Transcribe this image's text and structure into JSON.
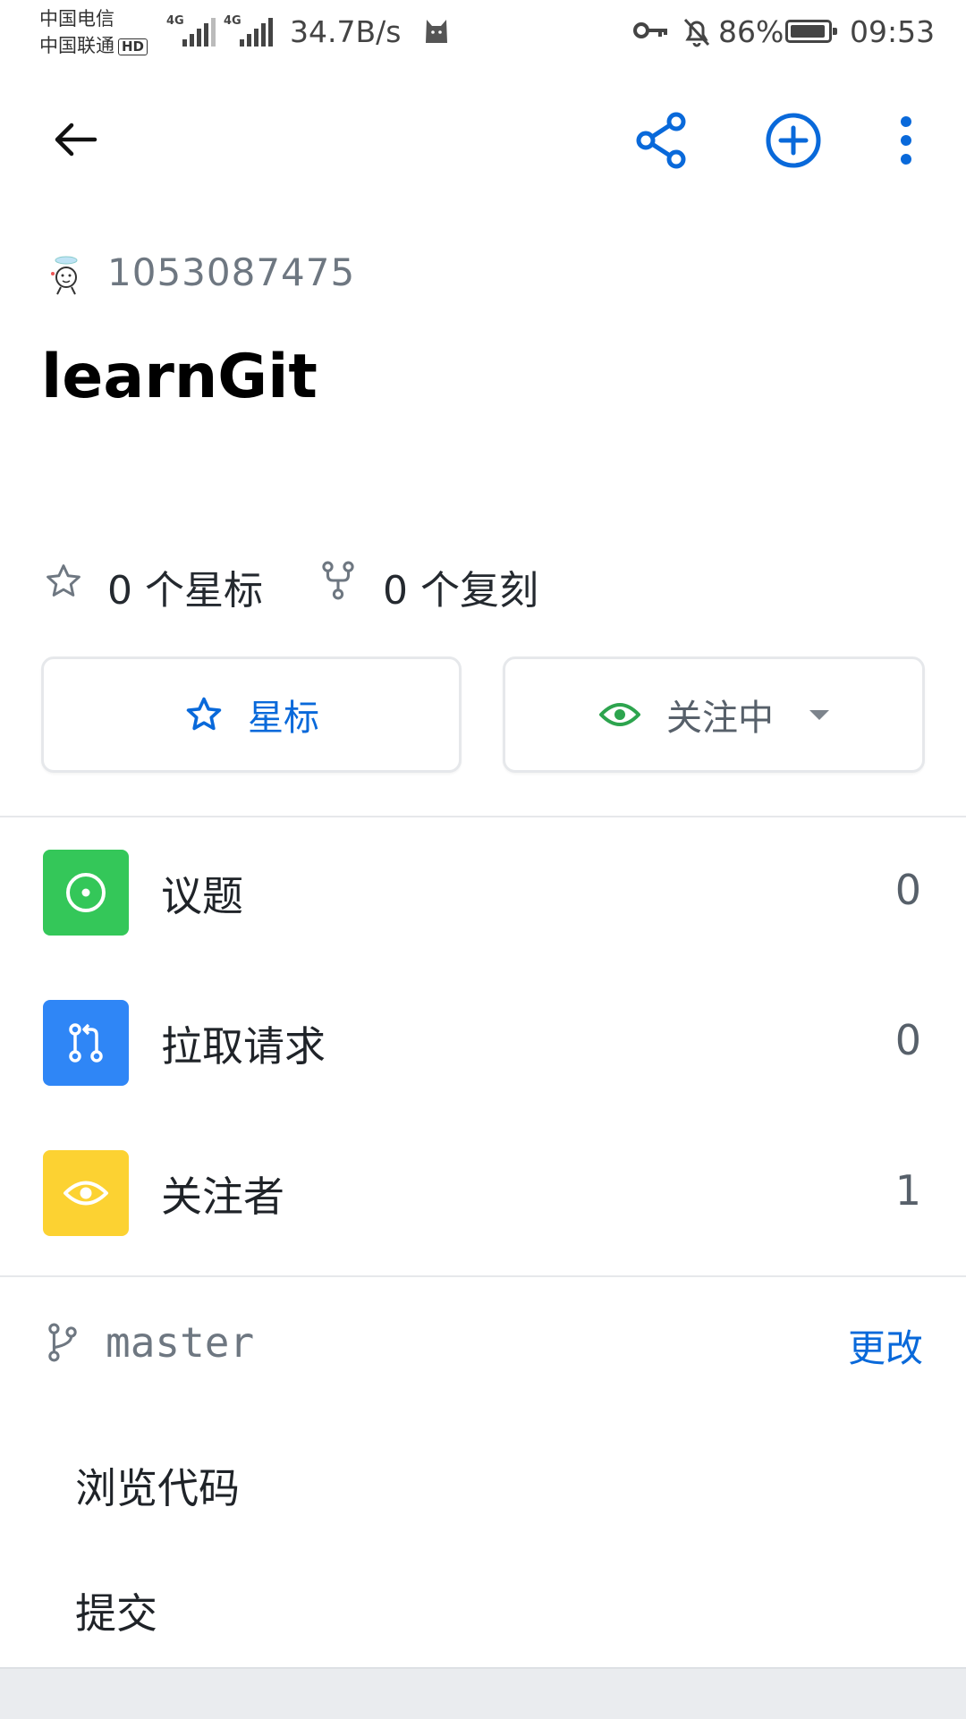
{
  "status_bar": {
    "carrier1": "中国电信",
    "carrier2": "中国联通",
    "hd_badge": "HD",
    "network1": "4G",
    "network2": "4G",
    "net_speed": "34.7B/s",
    "battery": "86%",
    "battery_level": 0.86,
    "time": "09:53",
    "icons": [
      "signal-icon",
      "cat-icon",
      "key-icon",
      "bell-off-icon",
      "battery-icon"
    ]
  },
  "app_bar": {
    "icons": [
      "back-arrow-icon",
      "share-icon",
      "add-circle-icon",
      "more-vert-icon"
    ],
    "accent_color": "#0969da"
  },
  "repo": {
    "owner": "1053087475",
    "name": "learnGit",
    "stars_text": "0 个星标",
    "forks_text": "0 个复刻"
  },
  "actions": {
    "star_label": "星标",
    "watch_label": "关注中"
  },
  "list": [
    {
      "label": "议题",
      "count": "0",
      "icon": "issue-opened-icon",
      "color": "#34c759"
    },
    {
      "label": "拉取请求",
      "count": "0",
      "icon": "pull-request-icon",
      "color": "#2f86f6"
    },
    {
      "label": "关注者",
      "count": "1",
      "icon": "eye-icon",
      "color": "#fcd232"
    }
  ],
  "branch": {
    "name": "master",
    "change_label": "更改"
  },
  "menu": {
    "browse_code": "浏览代码",
    "commits": "提交"
  }
}
